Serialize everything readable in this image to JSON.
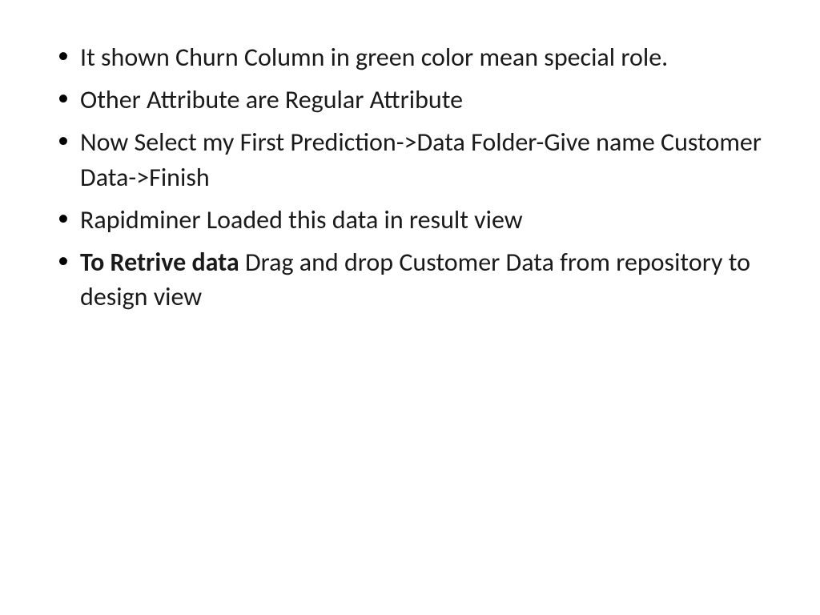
{
  "bullets": [
    {
      "parts": [
        {
          "text": "It shown Churn Column in green color mean special role.",
          "bold": false
        }
      ]
    },
    {
      "parts": [
        {
          "text": "Other Attribute are Regular Attribute",
          "bold": false
        }
      ]
    },
    {
      "parts": [
        {
          "text": "Now Select my First Prediction->Data Folder-Give name Customer Data->Finish",
          "bold": false
        }
      ]
    },
    {
      "parts": [
        {
          "text": "Rapidminer Loaded this data in result view",
          "bold": false
        }
      ]
    },
    {
      "parts": [
        {
          "text": "To Retrive data ",
          "bold": true
        },
        {
          "text": "Drag and drop Customer Data from repository to design view",
          "bold": false
        }
      ]
    }
  ]
}
